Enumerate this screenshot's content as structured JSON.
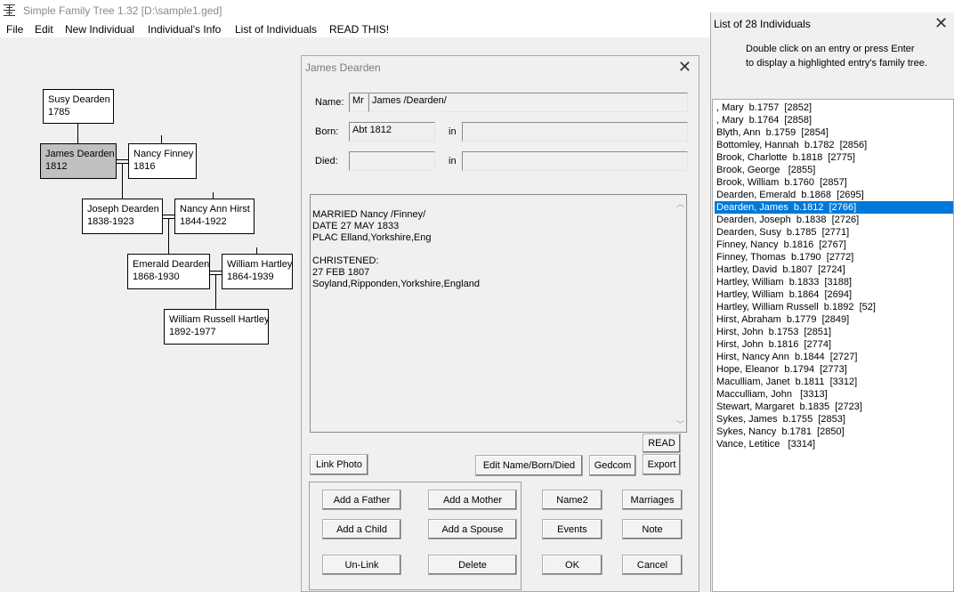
{
  "app": {
    "title": "Simple Family Tree 1.32  [D:\\sample1.ged]"
  },
  "menu": [
    "File",
    "Edit",
    "New Individual",
    "Individual's Info",
    "List of Individuals",
    "READ THIS!"
  ],
  "tree": {
    "people": [
      {
        "name": "Susy Dearden",
        "dates": "1785"
      },
      {
        "name": "James Dearden",
        "dates": "1812"
      },
      {
        "name": "Nancy Finney",
        "dates": "1816"
      },
      {
        "name": "Joseph Dearden",
        "dates": "1838-1923"
      },
      {
        "name": "Nancy Ann Hirst",
        "dates": "1844-1922"
      },
      {
        "name": "Emerald Dearden",
        "dates": "1868-1930"
      },
      {
        "name": "William Hartley",
        "dates": "1864-1939"
      },
      {
        "name": "William Russell Hartley",
        "dates": "1892-1977"
      }
    ]
  },
  "editor": {
    "title": "James Dearden",
    "name_label": "Name:",
    "prefix": "Mr",
    "name_value": "James /Dearden/",
    "born_label": "Born:",
    "born_value": "Abt 1812",
    "in_label": "in",
    "born_place": "",
    "died_label": "Died:",
    "died_value": "",
    "died_place": "",
    "notes": "MARRIED Nancy /Finney/\nDATE 27 MAY 1833\nPLAC Elland,Yorkshire,Eng\n\nCHRISTENED:\n27 FEB 1807\nSoyland,Ripponden,Yorkshire,England",
    "buttons": {
      "read": "READ",
      "link_photo": "Link Photo",
      "edit_name": "Edit Name/Born/Died",
      "gedcom": "Gedcom",
      "export": "Export",
      "add_father": "Add a Father",
      "add_mother": "Add a Mother",
      "add_child": "Add a Child",
      "add_spouse": "Add a Spouse",
      "unlink": "Un-Link",
      "delete": "Delete",
      "name2": "Name2",
      "marriages": "Marriages",
      "events": "Events",
      "note": "Note",
      "ok": "OK",
      "cancel": "Cancel"
    }
  },
  "list": {
    "title": "List of 28 Individuals",
    "instructions_line1": "Double click on an entry or press Enter",
    "instructions_line2": "to display a highlighted entry's family tree.",
    "selected_index": 8,
    "items": [
      ", Mary  b.1757  [2852]",
      ", Mary  b.1764  [2858]",
      "Blyth, Ann  b.1759  [2854]",
      "Bottomley, Hannah  b.1782  [2856]",
      "Brook, Charlotte  b.1818  [2775]",
      "Brook, George   [2855]",
      "Brook, William  b.1760  [2857]",
      "Dearden, Emerald  b.1868  [2695]",
      "Dearden, James  b.1812  [2766]",
      "Dearden, Joseph  b.1838  [2726]",
      "Dearden, Susy  b.1785  [2771]",
      "Finney, Nancy  b.1816  [2767]",
      "Finney, Thomas  b.1790  [2772]",
      "Hartley, David  b.1807  [2724]",
      "Hartley, William  b.1833  [3188]",
      "Hartley, William  b.1864  [2694]",
      "Hartley, William Russell  b.1892  [52]",
      "Hirst, Abraham  b.1779  [2849]",
      "Hirst, John  b.1753  [2851]",
      "Hirst, John  b.1816  [2774]",
      "Hirst, Nancy Ann  b.1844  [2727]",
      "Hope, Eleanor  b.1794  [2773]",
      "Maculliam, Janet  b.1811  [3312]",
      "Macculliam, John   [3313]",
      "Stewart, Margaret  b.1835  [2723]",
      "Sykes, James  b.1755  [2853]",
      "Sykes, Nancy  b.1781  [2850]",
      "Vance, Letitice   [3314]"
    ]
  }
}
